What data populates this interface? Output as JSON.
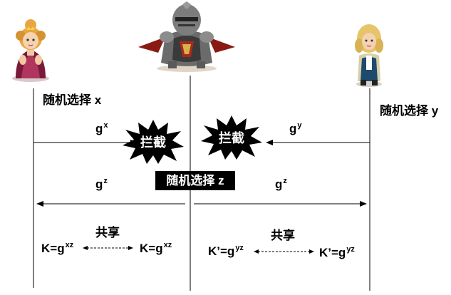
{
  "parties": {
    "alice": {
      "icon": "princess-avatar-icon"
    },
    "mallory": {
      "icon": "armored-knight-avatar-icon"
    },
    "bob": {
      "icon": "baroque-gentleman-avatar-icon"
    }
  },
  "left_choose": "随机选择 x",
  "right_choose": "随机选择 y",
  "middle_choose": "随机选择 z",
  "msg_gx": {
    "base": "g",
    "exp": "x"
  },
  "msg_gy": {
    "base": "g",
    "exp": "y"
  },
  "msg_gz_left": {
    "base": "g",
    "exp": "z"
  },
  "msg_gz_right": {
    "base": "g",
    "exp": "z"
  },
  "intercept_label": "拦截",
  "left_share": {
    "title": "共享",
    "k1": {
      "prefix": "K=g",
      "exp": "xz"
    },
    "k2": {
      "prefix": "K=g",
      "exp": "xz"
    }
  },
  "right_share": {
    "title": "共享",
    "k1": {
      "prefix": "K’=g",
      "exp": "yz"
    },
    "k2": {
      "prefix": "K’=g",
      "exp": "yz"
    }
  },
  "colors": {
    "line": "#000000",
    "burst": "#000000",
    "label_box": "#000000",
    "label_text": "#ffffff"
  }
}
